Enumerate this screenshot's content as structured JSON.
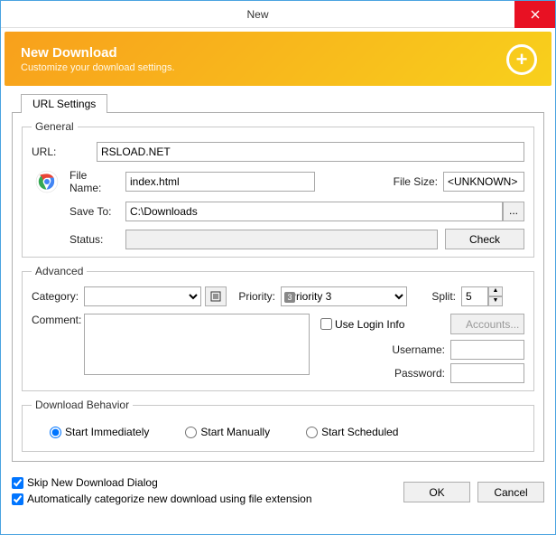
{
  "window": {
    "title": "New"
  },
  "header": {
    "title": "New Download",
    "subtitle": "Customize your download settings."
  },
  "tab": {
    "label": "URL Settings"
  },
  "general": {
    "legend": "General",
    "url_label": "URL:",
    "url_value": "RSLOAD.NET",
    "filename_label": "File Name:",
    "filename_value": "index.html",
    "filesize_label": "File Size:",
    "filesize_value": "<UNKNOWN>",
    "saveto_label": "Save To:",
    "saveto_value": "C:\\Downloads",
    "browse_label": "...",
    "status_label": "Status:",
    "status_value": "",
    "check_label": "Check"
  },
  "advanced": {
    "legend": "Advanced",
    "category_label": "Category:",
    "category_value": "",
    "priority_label": "Priority:",
    "priority_value": "Priority 3",
    "priority_num": "3",
    "split_label": "Split:",
    "split_value": "5",
    "comment_label": "Comment:",
    "comment_value": "",
    "use_login_label": "Use Login Info",
    "accounts_label": "Accounts...",
    "username_label": "Username:",
    "username_value": "",
    "password_label": "Password:",
    "password_value": ""
  },
  "behavior": {
    "legend": "Download Behavior",
    "start_immediately": "Start Immediately",
    "start_manually": "Start Manually",
    "start_scheduled": "Start Scheduled"
  },
  "footer": {
    "skip_dialog": "Skip New Download Dialog",
    "auto_categorize": "Automatically categorize new download using file extension",
    "ok": "OK",
    "cancel": "Cancel"
  }
}
